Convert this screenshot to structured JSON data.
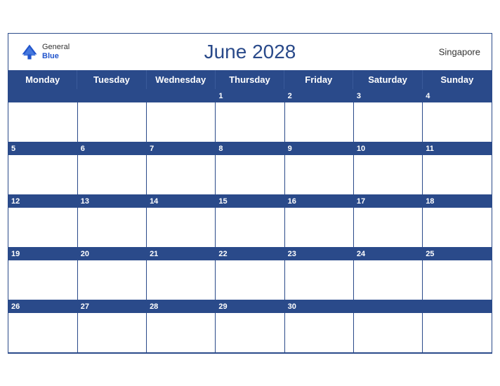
{
  "header": {
    "title": "June 2028",
    "region": "Singapore",
    "logo": {
      "general": "General",
      "blue": "Blue"
    }
  },
  "days": [
    "Monday",
    "Tuesday",
    "Wednesday",
    "Thursday",
    "Friday",
    "Saturday",
    "Sunday"
  ],
  "weeks": [
    [
      "",
      "",
      "",
      "1",
      "2",
      "3",
      "4"
    ],
    [
      "5",
      "6",
      "7",
      "8",
      "9",
      "10",
      "11"
    ],
    [
      "12",
      "13",
      "14",
      "15",
      "16",
      "17",
      "18"
    ],
    [
      "19",
      "20",
      "21",
      "22",
      "23",
      "24",
      "25"
    ],
    [
      "26",
      "27",
      "28",
      "29",
      "30",
      "",
      ""
    ]
  ],
  "colors": {
    "primary": "#2a4a8a",
    "header_text": "#ffffff",
    "title": "#2a4a8a"
  }
}
